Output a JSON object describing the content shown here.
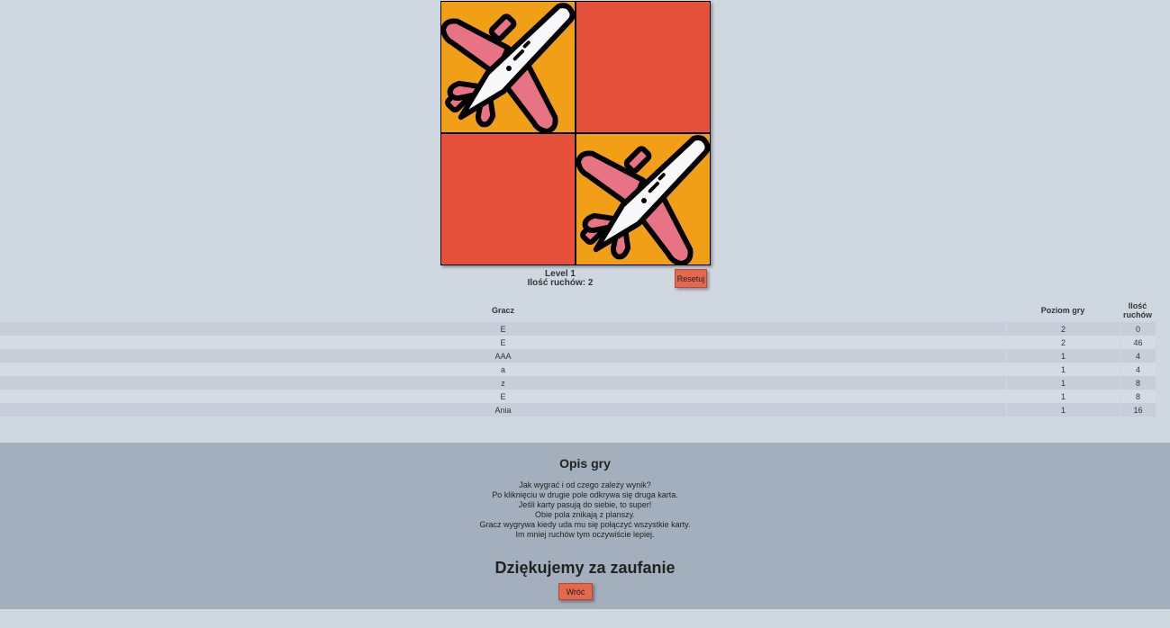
{
  "board": {
    "cards": [
      {
        "state": "revealed",
        "icon": "airplane-icon"
      },
      {
        "state": "hidden",
        "icon": ""
      },
      {
        "state": "hidden",
        "icon": ""
      },
      {
        "state": "revealed",
        "icon": "airplane-icon"
      }
    ],
    "colors": {
      "hidden": "#e5513a",
      "revealed": "#f29f18"
    }
  },
  "status": {
    "level": "Level 1",
    "moves": "Ilość ruchów: 2"
  },
  "buttons": {
    "reset": "Resetuj",
    "back": "Wróć"
  },
  "scores": {
    "headers": {
      "player": "Gracz",
      "level": "Poziom gry",
      "moves_line1": "Ilość",
      "moves_line2": "ruchów"
    },
    "rows": [
      {
        "player": "E",
        "level": "2",
        "moves": "0"
      },
      {
        "player": "E",
        "level": "2",
        "moves": "46"
      },
      {
        "player": "AAA",
        "level": "1",
        "moves": "4"
      },
      {
        "player": "a",
        "level": "1",
        "moves": "4"
      },
      {
        "player": "z",
        "level": "1",
        "moves": "8"
      },
      {
        "player": "E",
        "level": "1",
        "moves": "8"
      },
      {
        "player": "Ania",
        "level": "1",
        "moves": "16"
      }
    ]
  },
  "footer": {
    "title": "Opis gry",
    "lines": [
      "Jak wygrać i od czego zależy wynik?",
      "Po kliknięciu w drugie pole odkrywa się druga karta.",
      "Jeśli karty pasują do siebie, to super!",
      "Obie pola znikają z planszy.",
      "Gracz wygrywa kiedy uda mu się połączyć wszystkie karty.",
      "Im mniej ruchów tym oczywiście lepiej."
    ],
    "thanks": "Dziękujemy za zaufanie"
  }
}
